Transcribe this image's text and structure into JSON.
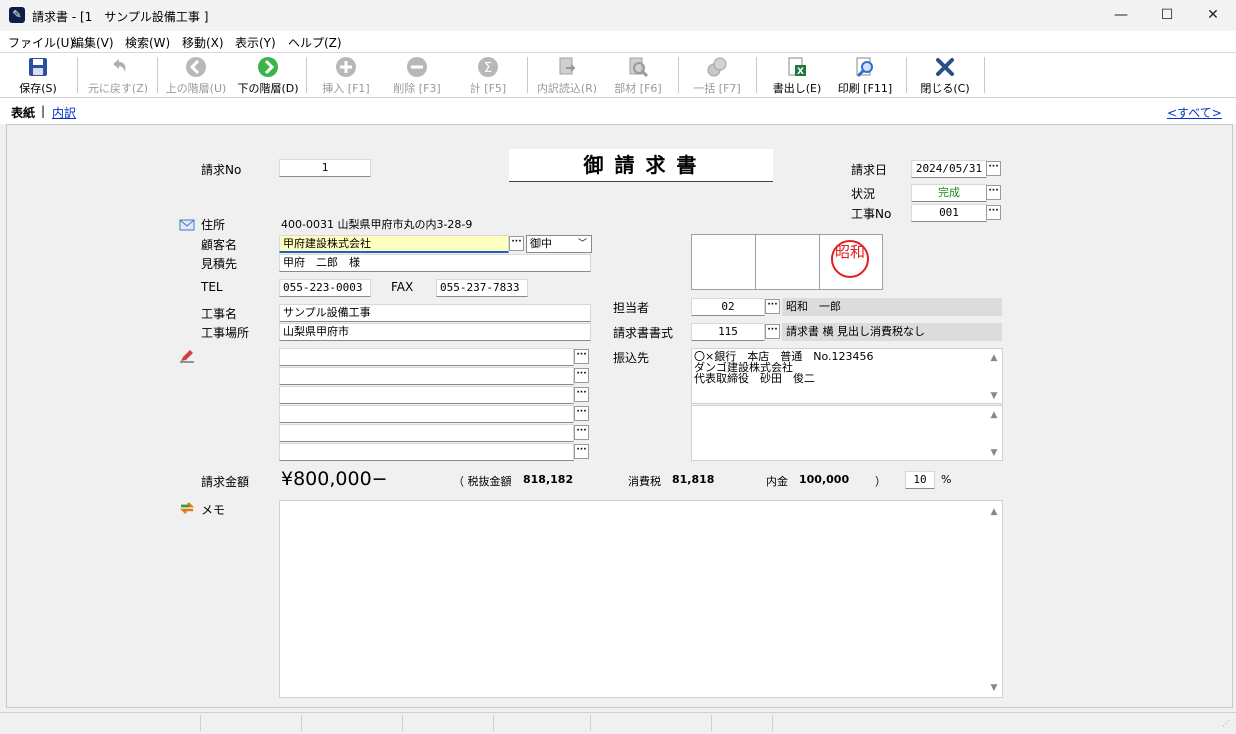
{
  "window": {
    "title": "請求書 - [1　サンプル設備工事 ]",
    "minimize": "—",
    "maximize": "☐",
    "close": "✕"
  },
  "menu": [
    "ファイル(U)",
    "編集(V)",
    "検索(W)",
    "移動(X)",
    "表示(Y)",
    "ヘルプ(Z)"
  ],
  "toolbar": {
    "save": "保存(S)",
    "undo": "元に戻す(Z)",
    "up": "上の階層(U)",
    "down": "下の階層(D)",
    "insert": "挿入 [F1]",
    "delete": "削除 [F3]",
    "sum": "計 [F5]",
    "import": "内訳読込(R)",
    "parts": "部材 [F6]",
    "bulk": "一括 [F7]",
    "export": "書出し(E)",
    "print": "印刷 [F11]",
    "close": "閉じる(C)"
  },
  "tabs": {
    "cover": "表紙",
    "separator": "|",
    "detail": "内訳",
    "all": "<すべて>"
  },
  "doc_title": "御 請 求 書",
  "invoice_no": {
    "label": "請求No",
    "value": "1"
  },
  "invoice_date": {
    "label": "請求日",
    "value": "2024/05/31"
  },
  "status": {
    "label": "状況",
    "value": "完成"
  },
  "project_no": {
    "label": "工事No",
    "value": "001"
  },
  "address": {
    "label": "住所",
    "value": "400-0031 山梨県甲府市丸の内3-28-9"
  },
  "customer": {
    "label": "顧客名",
    "value": "甲府建設株式会社",
    "honorific": "御中"
  },
  "quote_to": {
    "label": "見積先",
    "value": "甲府　二郎　様"
  },
  "tel": {
    "label": "TEL",
    "value": "055-223-0003"
  },
  "fax": {
    "label": "FAX",
    "value": "055-237-7833"
  },
  "project_name": {
    "label": "工事名",
    "value": "サンプル設備工事"
  },
  "project_site": {
    "label": "工事場所",
    "value": "山梨県甲府市"
  },
  "stamp": {
    "text": "昭和",
    "color": "#e02020"
  },
  "staff": {
    "label": "担当者",
    "code": "02",
    "name": "昭和　一郎"
  },
  "format": {
    "label": "請求書書式",
    "code": "115",
    "name": "請求書 横 見出し消費税なし"
  },
  "bank": {
    "label": "振込先",
    "lines": [
      "〇×銀行　本店　普通　No.123456",
      "ダンゴ建設株式会社",
      "代表取締役　砂田　俊二"
    ]
  },
  "amounts": {
    "label": "請求金額",
    "total": "¥800,000−",
    "pretax_label": "（ 税抜金額",
    "pretax": "818,182",
    "tax_label": "消費税",
    "tax": "81,818",
    "deposit_label": "内金",
    "deposit": "100,000",
    "close_paren": "）",
    "tax_rate": "10",
    "percent": "%"
  },
  "memo": {
    "label": "メモ"
  },
  "colors": {
    "accent": "#0a64c8",
    "customer_bg": "#ffffc0",
    "status_text": "#1a8a1a"
  }
}
